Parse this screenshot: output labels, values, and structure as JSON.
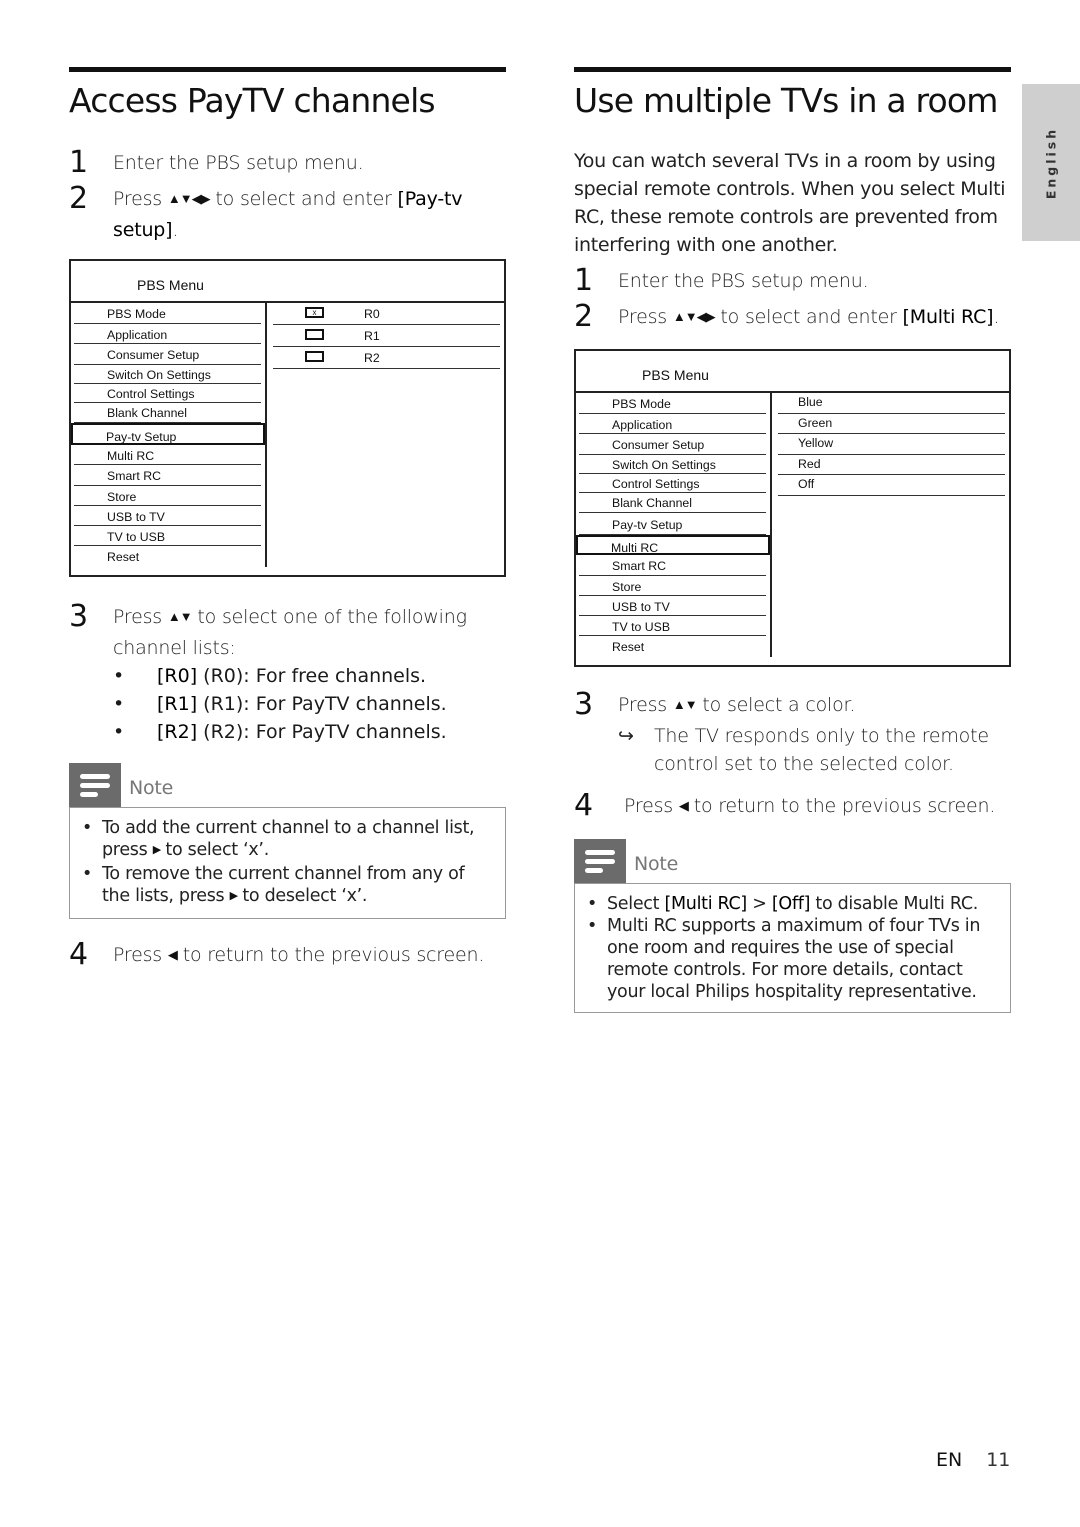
{
  "left": {
    "title": "Access PayTV channels",
    "steps": [
      {
        "num": "1",
        "text": "Enter the PBS setup menu."
      },
      {
        "num": "2",
        "pre": "Press ",
        "arrows": "▲▼◀▶",
        "mid": " to select and enter ",
        "bold": "[Pay-tv setup]",
        "post": "."
      },
      {
        "num": "3",
        "pre": "Press ",
        "arrows": "▲▼",
        "mid": " to select one of the following channel lists:"
      },
      {
        "num": "4",
        "pre": "Press ",
        "arrows": "◀",
        "mid": " to return to the previous screen."
      }
    ],
    "channel_lists": [
      {
        "bold": "[R0]",
        "text": " (R0): For free channels."
      },
      {
        "bold": "[R1]",
        "text": " (R1): For PayTV channels."
      },
      {
        "bold": "[R2]",
        "text": " (R2): For PayTV channels."
      }
    ],
    "menu": {
      "title": "PBS Menu",
      "items": [
        "PBS Mode",
        "Application",
        "Consumer Setup",
        "Switch On Settings",
        "Control Settings",
        "Blank Channel",
        "Pay-tv Setup",
        "Multi RC",
        "Smart RC",
        "Store",
        "USB to TV",
        "TV to USB",
        "Reset"
      ],
      "selected": "Pay-tv Setup",
      "options": [
        {
          "label": "R0",
          "checked": true,
          "mark": "x"
        },
        {
          "label": "R1",
          "checked": false,
          "mark": ""
        },
        {
          "label": "R2",
          "checked": false,
          "mark": ""
        }
      ]
    },
    "note": {
      "label": "Note",
      "items": [
        {
          "pre": "To add the current channel to a channel list, press ",
          "arrow": "▶",
          "post": " to select ‘x’."
        },
        {
          "pre": "To remove the current channel from any of the lists, press ",
          "arrow": "▶",
          "post": " to deselect ‘x’."
        }
      ]
    }
  },
  "right": {
    "title": "Use multiple TVs in a room",
    "intro": "You can watch several TVs in a room by using special remote controls. When you select Multi RC, these remote controls are prevented from interfering with one another.",
    "steps": [
      {
        "num": "1",
        "text": "Enter the PBS setup menu."
      },
      {
        "num": "2",
        "pre": "Press ",
        "arrows": "▲▼◀▶",
        "mid": " to select and enter ",
        "bold": "[Multi RC]",
        "post": "."
      },
      {
        "num": "3",
        "pre": "Press ",
        "arrows": "▲▼",
        "mid": " to select a color.",
        "result_arrow": "↪",
        "result": "The TV responds only to the remote control set to the selected color."
      },
      {
        "num": "4",
        "pre": "Press ",
        "arrows": "◀",
        "mid": " to return to the previous screen."
      }
    ],
    "menu": {
      "title": "PBS Menu",
      "items": [
        "PBS Mode",
        "Application",
        "Consumer Setup",
        "Switch On Settings",
        "Control Settings",
        "Blank Channel",
        "Pay-tv Setup",
        "Multi RC",
        "Smart RC",
        "Store",
        "USB to TV",
        "TV to USB",
        "Reset"
      ],
      "selected": "Multi RC",
      "options": [
        "Blue",
        "Green",
        "Yellow",
        "Red",
        "Off"
      ]
    },
    "note": {
      "label": "Note",
      "items": [
        {
          "pre": "Select ",
          "bold1": "[Multi RC]",
          "mid": " > ",
          "bold2": "[Off]",
          "post": " to disable Multi RC."
        },
        {
          "text": "Multi RC supports a maximum of four TVs in one room and requires the use of special remote controls. For more details, contact your local Philips hospitality representative."
        }
      ]
    }
  },
  "side_tab": "English",
  "footer": {
    "lang": "EN",
    "page": "11"
  }
}
